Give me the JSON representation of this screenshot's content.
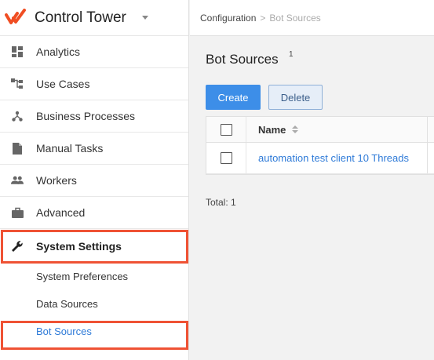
{
  "app": {
    "title": "Control Tower",
    "brand_color": "#f04e23",
    "accent_color": "#3d8ee8",
    "highlight_color": "#ef5234"
  },
  "sidebar": {
    "items": [
      {
        "label": "Analytics",
        "icon": "dashboard-icon"
      },
      {
        "label": "Use Cases",
        "icon": "hierarchy-icon"
      },
      {
        "label": "Business Processes",
        "icon": "process-icon"
      },
      {
        "label": "Manual Tasks",
        "icon": "document-icon"
      },
      {
        "label": "Workers",
        "icon": "people-icon"
      },
      {
        "label": "Advanced",
        "icon": "briefcase-icon"
      },
      {
        "label": "System Settings",
        "icon": "wrench-icon"
      }
    ],
    "subitems": [
      {
        "label": "System Preferences"
      },
      {
        "label": "Data Sources"
      },
      {
        "label": "Bot Sources"
      }
    ]
  },
  "breadcrumb": {
    "parent": "Configuration",
    "separator": ">",
    "current": "Bot Sources"
  },
  "main": {
    "title": "Bot Sources",
    "count": "1",
    "create_label": "Create",
    "delete_label": "Delete",
    "table": {
      "columns": [
        "Name"
      ],
      "rows": [
        {
          "name": "automation test client 10 Threads"
        }
      ]
    },
    "total_text": "Total: 1"
  }
}
